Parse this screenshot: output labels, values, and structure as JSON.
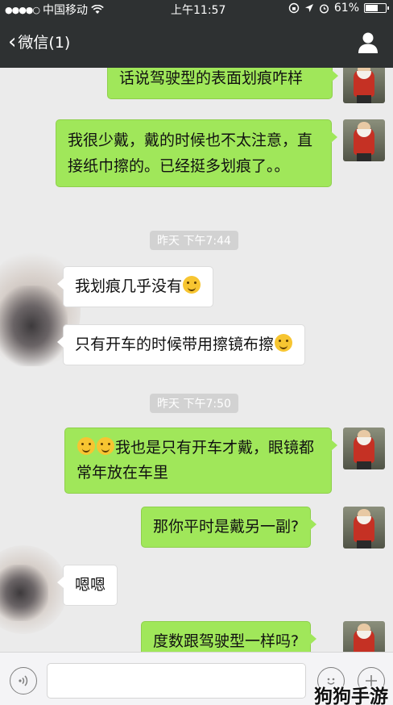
{
  "status_bar": {
    "carrier": "中国移动",
    "time": "上午11:57",
    "battery_percent": "61%",
    "battery_level": 0.61
  },
  "nav": {
    "back_label": "微信(1)",
    "profile_icon": "person-icon"
  },
  "messages": [
    {
      "side": "mine",
      "text": "话说驾驶型的表面划痕咋样"
    },
    {
      "side": "mine",
      "text": "我很少戴，戴的时候也不太注意，直接纸巾擦的。已经挺多划痕了。。"
    },
    {
      "type": "timestamp",
      "text": "昨天 下午7:44"
    },
    {
      "side": "theirs",
      "text": "我划痕几乎没有",
      "emoji_after": "thinking-face-emoji"
    },
    {
      "side": "theirs",
      "text": "只有开车的时候带用擦镜布擦",
      "emoji_after": "grinning-face-emoji"
    },
    {
      "type": "timestamp",
      "text": "昨天 下午7:50"
    },
    {
      "side": "mine",
      "text": "我也是只有开车才戴，眼镜都常年放在车里",
      "emoji_before": [
        "rolling-laughing-emoji",
        "rolling-laughing-emoji"
      ]
    },
    {
      "side": "mine",
      "text": "那你平时是戴另一副?"
    },
    {
      "side": "theirs",
      "text": "嗯嗯"
    },
    {
      "side": "mine",
      "text": "度数跟驾驶型一样吗?"
    }
  ],
  "input_bar": {
    "voice_icon": "voice-icon",
    "emoji_icon": "smiley-icon",
    "plus_icon": "plus-icon"
  },
  "watermark": "狗狗手游"
}
